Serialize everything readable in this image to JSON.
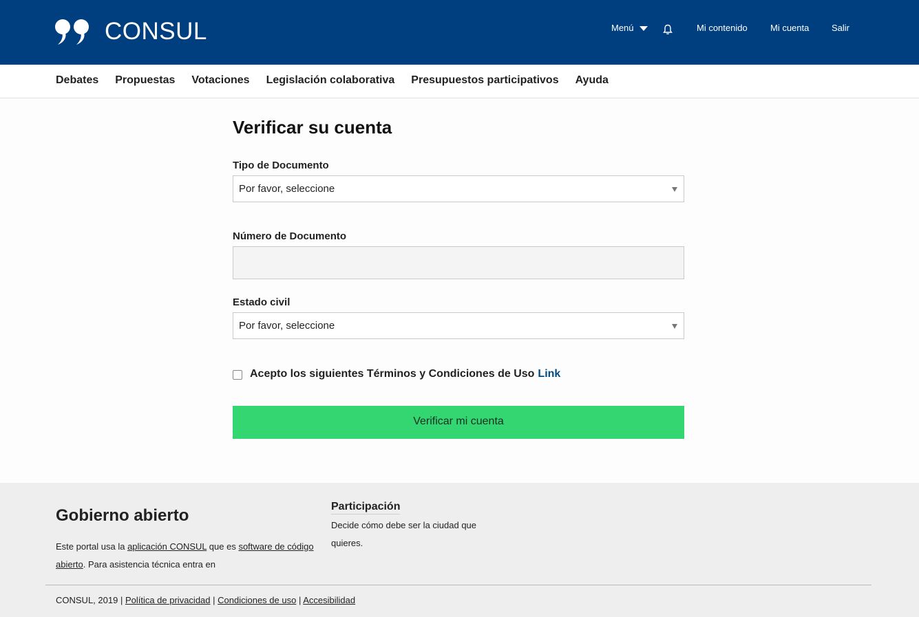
{
  "brand": {
    "name": "CONSUL",
    "color": "#003f7f"
  },
  "topnav": {
    "menu_label": "Menú",
    "my_content": "Mi contenido",
    "my_account": "Mi cuenta",
    "logout": "Salir"
  },
  "mainnav": {
    "items": [
      "Debates",
      "Propuestas",
      "Votaciones",
      "Legislación colaborativa",
      "Presupuestos participativos",
      "Ayuda"
    ]
  },
  "form": {
    "title": "Verificar su cuenta",
    "document_type": {
      "label": "Tipo de Documento",
      "value": "Por favor, seleccione"
    },
    "document_number": {
      "label": "Número de Documento",
      "value": ""
    },
    "civil_status": {
      "label": "Estado civil",
      "value": "Por favor, seleccione"
    },
    "terms": {
      "text": "Acepto los siguientes Términos y Condiciones de Uso",
      "link": "Link",
      "checked": false
    },
    "submit_label": "Verificar mi cuenta",
    "submit_color": "#33d671"
  },
  "footer": {
    "title": "Gobierno abierto",
    "desc_prefix": "Este portal usa la ",
    "desc_link1": "aplicación CONSUL",
    "desc_mid": " que es ",
    "desc_link2": "software de código abierto",
    "desc_suffix": ". Para asistencia técnica entra en",
    "participation_title": "Participación",
    "participation_desc": "Decide cómo debe ser la ciudad que quieres.",
    "copyright": "CONSUL, 2019",
    "sep": " | ",
    "links": [
      "Política de privacidad",
      "Condiciones de uso",
      "Accesibilidad"
    ]
  }
}
